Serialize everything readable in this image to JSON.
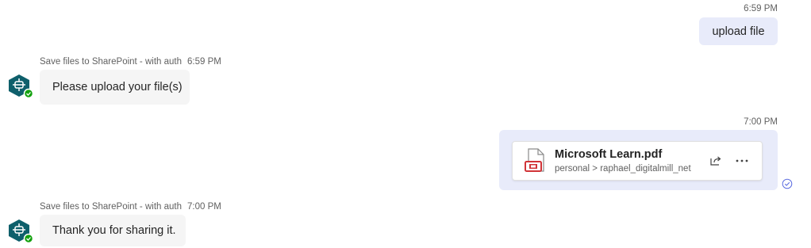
{
  "messages": {
    "user_1": {
      "time": "6:59 PM",
      "text": "upload file"
    },
    "bot_1": {
      "sender": "Save files to SharePoint - with auth",
      "time": "6:59 PM",
      "text": "Please upload your file(s)"
    },
    "user_2": {
      "time": "7:00 PM",
      "file": {
        "name": "Microsoft Learn.pdf",
        "path": "personal > raphael_digitalmill_net",
        "type_icon": "pdf-file-icon"
      },
      "actions": [
        "share-icon",
        "more-options-icon"
      ],
      "status_icon": "sent-check-icon"
    },
    "bot_2": {
      "sender": "Save files to SharePoint - with auth",
      "time": "7:00 PM",
      "text": "Thank you for sharing it."
    }
  },
  "colors": {
    "user_bubble": "#e8ebfa",
    "bot_bubble": "#f5f5f5",
    "bot_avatar": "#0e5f6b",
    "online_badge": "#13a10e",
    "pdf_red": "#d13438",
    "status_blue": "#5b6ce0"
  }
}
